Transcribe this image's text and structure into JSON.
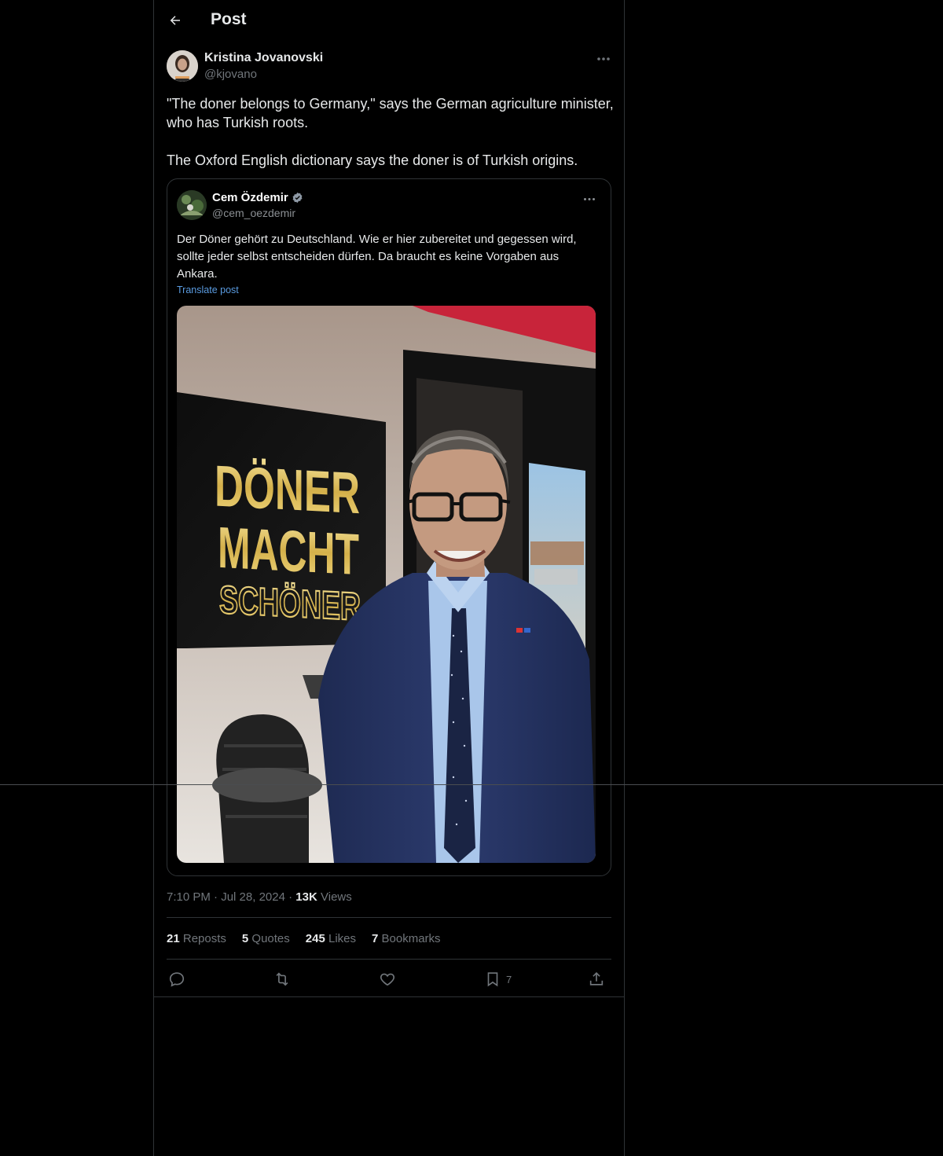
{
  "header": {
    "title": "Post",
    "back_icon": "arrow-left-icon"
  },
  "author": {
    "name": "Kristina Jovanovski",
    "handle": "@kjovano"
  },
  "post": {
    "paragraphs": [
      "\"The doner belongs to Germany,\" says the German agriculture minister, who has Turkish roots.",
      "The Oxford English dictionary says the doner is of Turkish origins."
    ]
  },
  "embedded_post": {
    "name": "Cem Özdemir",
    "handle": "@cem_oezdemir",
    "text": "Der Döner gehört zu Deutschland. Wie er hier zubereitet und gegessen wird, sollte jeder selbst entscheiden dürfen. Da braucht es keine Vorgaben aus Ankara.",
    "translate_label": "Translate post",
    "photo_sign": [
      "DÖNER",
      "MACHT",
      "SCHÖNER"
    ]
  },
  "meta": {
    "time": "7:10 PM",
    "date": "Jul 28, 2024",
    "views_count": "13K",
    "views_label": "Views"
  },
  "stats": {
    "reposts": {
      "count": "21",
      "label": "Reposts"
    },
    "quotes": {
      "count": "5",
      "label": "Quotes"
    },
    "likes": {
      "count": "245",
      "label": "Likes"
    },
    "bookmarks": {
      "count": "7",
      "label": "Bookmarks"
    }
  },
  "actions": {
    "reply_icon": "reply-icon",
    "repost_icon": "repost-icon",
    "like_icon": "heart-icon",
    "bookmark_icon": "bookmark-icon",
    "bookmark_count": "7",
    "share_icon": "share-icon"
  },
  "colors": {
    "background": "#000000",
    "text": "#e7e9ea",
    "muted": "#71767b",
    "border": "#2f3336",
    "link": "#5a9be0"
  }
}
